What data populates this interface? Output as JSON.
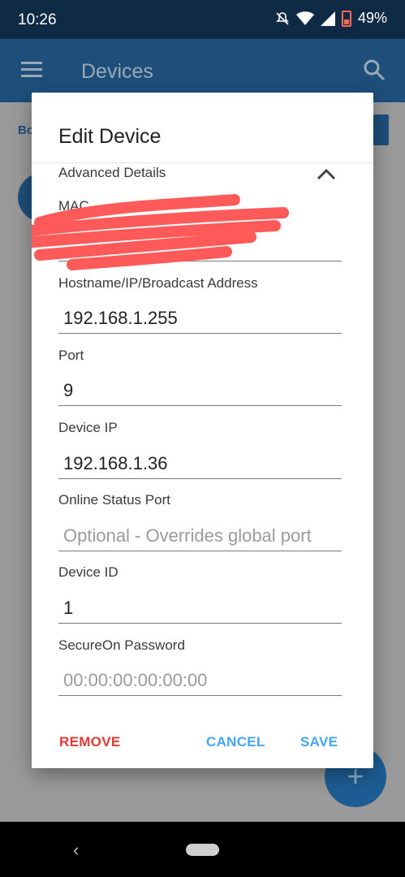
{
  "status_bar": {
    "time": "10:26",
    "battery_percent": "49%",
    "icons": [
      "notifications-off-icon",
      "wifi-icon",
      "signal-icon",
      "battery-icon"
    ]
  },
  "app_bar": {
    "title": "Devices",
    "icons": [
      "menu-icon",
      "search-icon"
    ]
  },
  "background": {
    "label": "Bo",
    "fab_label": "+"
  },
  "dialog": {
    "title": "Edit Device",
    "section_label": "Advanced Details",
    "fields": {
      "mac": {
        "label": "MAC"
      },
      "hostname": {
        "label": "Hostname/IP/Broadcast Address",
        "value": "192.168.1.255"
      },
      "port": {
        "label": "Port",
        "value": "9"
      },
      "device_ip": {
        "label": "Device IP",
        "value": "192.168.1.36"
      },
      "online_status_port": {
        "label": "Online Status Port",
        "placeholder": "Optional - Overrides global port"
      },
      "device_id": {
        "label": "Device ID",
        "value": "1"
      },
      "secureon_password": {
        "label": "SecureOn Password",
        "placeholder": "00:00:00:00:00:00"
      }
    },
    "actions": {
      "remove": "REMOVE",
      "cancel": "CANCEL",
      "save": "SAVE"
    }
  },
  "nav_bar": {
    "back_glyph": "‹"
  },
  "colors": {
    "primary": "#1d4f7a",
    "accent": "#42a5f5",
    "danger": "#e53935",
    "redaction": "#ff5a5a"
  }
}
